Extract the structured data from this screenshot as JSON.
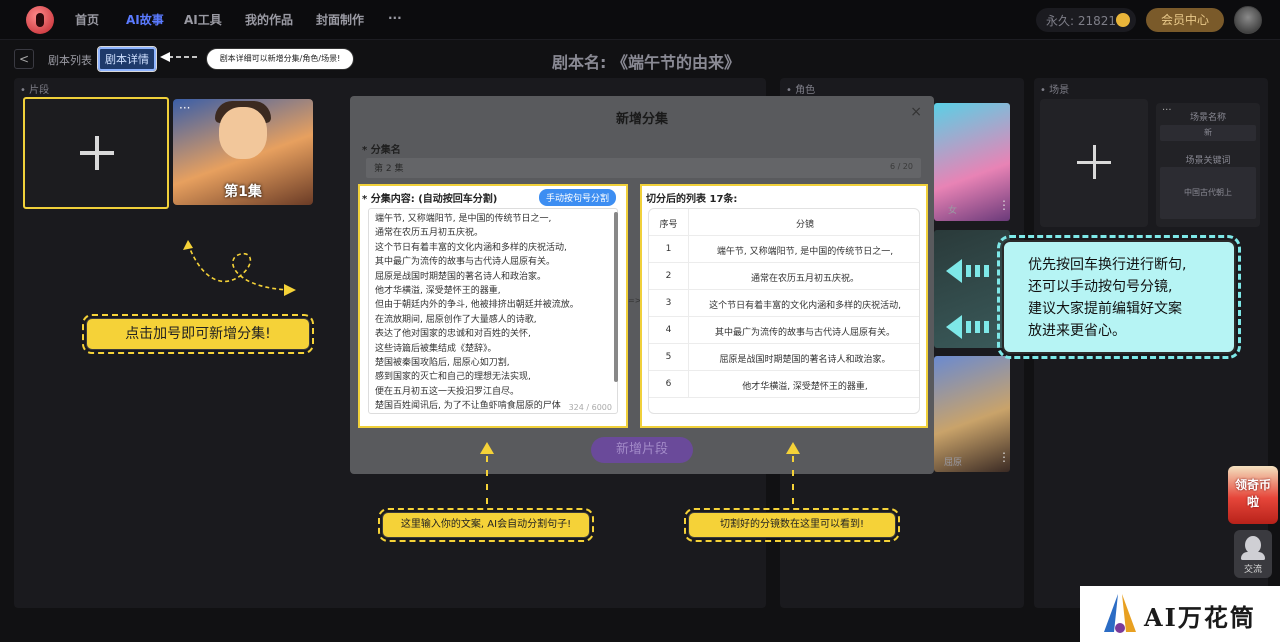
{
  "nav": {
    "items": [
      "首页",
      "AI故事",
      "AI工具",
      "我的作品",
      "封面制作",
      "···"
    ],
    "active_index": 1,
    "points": "永久: 21821",
    "vip": "会员中心"
  },
  "subbar": {
    "back": "<",
    "tab_list": "剧本列表",
    "tab_detail": "剧本详情",
    "tip": "剧本详细可以新增分集/角色/场景!",
    "title": "剧本名: 《端午节的由来》"
  },
  "panels": {
    "segments": "片段",
    "roles": "角色",
    "scenes": "场景",
    "episode_card": "第1集",
    "scene_name_label": "场景名称",
    "scene_name_value": "新",
    "scene_keyword_label": "场景关键词",
    "scene_keyword_value": "中国古代朝上",
    "char_1": "女",
    "char_3": "屈原"
  },
  "modal": {
    "title": "新增分集",
    "close": "×",
    "ep_label": "* 分集名",
    "ep_value": "第 2 集",
    "ep_count": "6 / 20",
    "content_label": "* 分集内容: (自动按回车分割)",
    "manual_btn": "手动按句号分割",
    "content_lines": [
      "端午节, 又称端阳节, 是中国的传统节日之一,",
      "通常在农历五月初五庆祝。",
      "这个节日有着丰富的文化内涵和多样的庆祝活动,",
      "其中最广为流传的故事与古代诗人屈原有关。",
      "屈原是战国时期楚国的著名诗人和政治家。",
      "他才华横溢, 深受楚怀王的器重,",
      "但由于朝廷内外的争斗, 他被排挤出朝廷并被流放。",
      "在流放期间, 屈原创作了大量感人的诗歌,",
      "表达了他对国家的忠诚和对百姓的关怀,",
      "这些诗篇后被集结成《楚辞》。",
      "楚国被秦国攻陷后, 屈原心如刀割,",
      "感到国家的灭亡和自己的理想无法实现,",
      "便在五月初五这一天投汨罗江自尽。",
      "楚国百姓闻讯后, 为了不让鱼虾啃食屈原的尸体"
    ],
    "content_count": "324 / 6000",
    "list_label": "切分后的列表 17条:",
    "list_header_no": "序号",
    "list_header_text": "分镜",
    "list_rows": [
      {
        "no": "1",
        "text": "端午节, 又称端阳节, 是中国的传统节日之一,"
      },
      {
        "no": "2",
        "text": "通常在农历五月初五庆祝。"
      },
      {
        "no": "3",
        "text": "这个节日有着丰富的文化内涵和多样的庆祝活动,"
      },
      {
        "no": "4",
        "text": "其中最广为流传的故事与古代诗人屈原有关。"
      },
      {
        "no": "5",
        "text": "屈原是战国时期楚国的著名诗人和政治家。"
      },
      {
        "no": "6",
        "text": "他才华横溢, 深受楚怀王的器重,"
      }
    ],
    "new_segment": "新增片段"
  },
  "callouts": {
    "add_tip": "点击加号即可新增分集!",
    "input_tip": "这里输入你的文案, AI会自动分割句子!",
    "list_tip": "切割好的分镜数在这里可以看到!",
    "right_tip": [
      "优先按回车换行进行断句,",
      "还可以手动按句号分镜,",
      "建议大家提前编辑好文案",
      "放进来更省心。"
    ]
  },
  "floating": {
    "gift": "领奇币啦",
    "chat": "交流"
  },
  "watermark": "AI万花筒",
  "colors": {
    "highlight": "#f0d03a",
    "cyan": "#b6f4f4",
    "accent": "#5b7bff"
  }
}
